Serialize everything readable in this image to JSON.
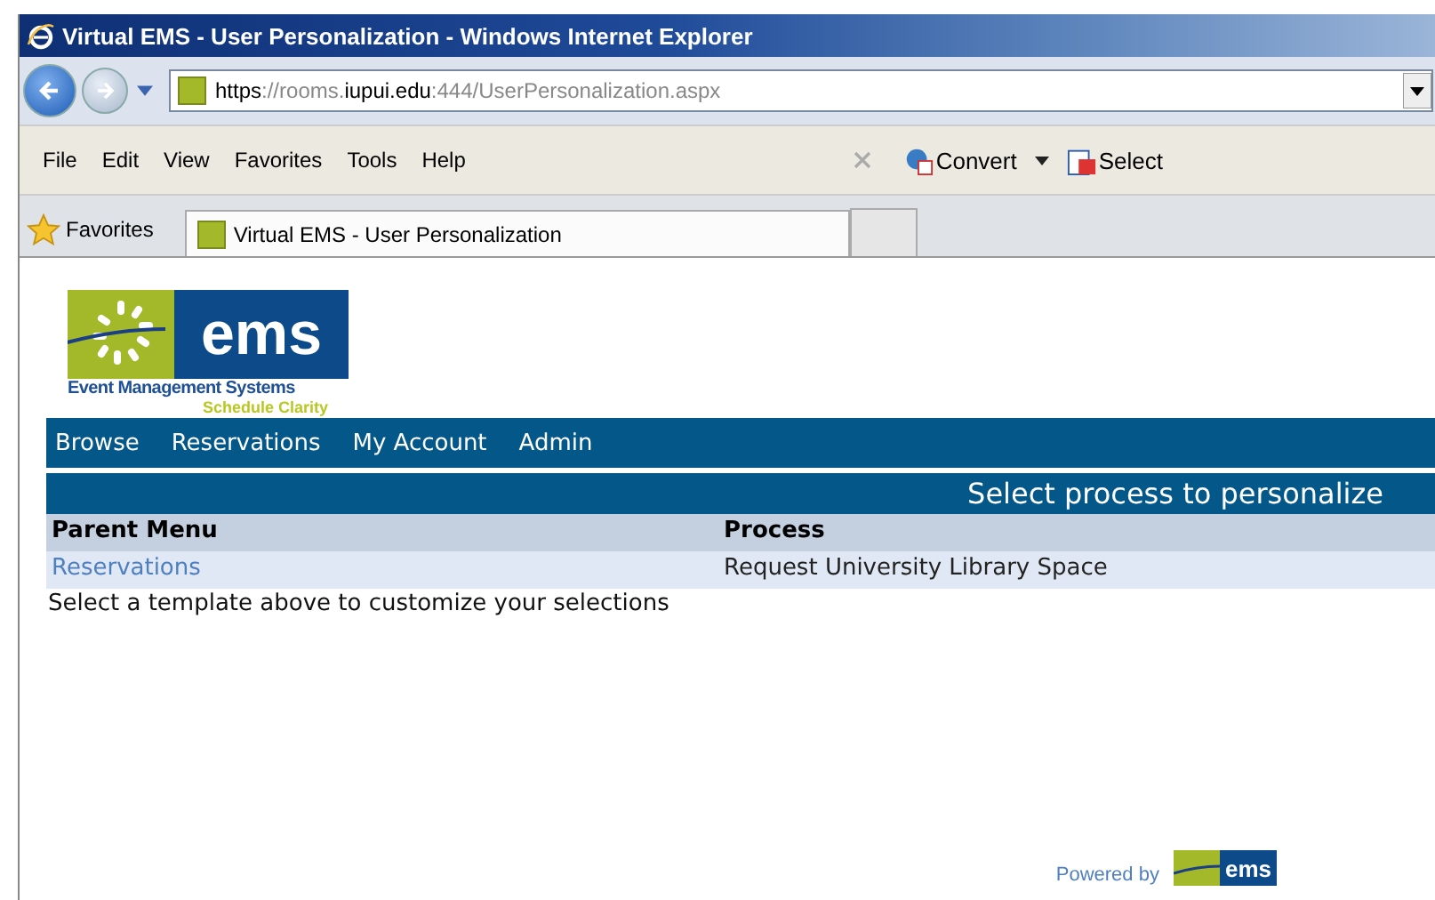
{
  "window": {
    "title": "Virtual EMS - User Personalization - Windows Internet Explorer"
  },
  "address_bar": {
    "url_parts": [
      {
        "text": "https",
        "dim": false
      },
      {
        "text": "://rooms.",
        "dim": true
      },
      {
        "text": "iupui.edu",
        "dim": false
      },
      {
        "text": ":444/UserPersonalization.aspx",
        "dim": true
      }
    ]
  },
  "menu": [
    "File",
    "Edit",
    "View",
    "Favorites",
    "Tools",
    "Help"
  ],
  "toolbar": {
    "convert": "Convert",
    "select": "Select"
  },
  "favorites_bar": {
    "label": "Favorites",
    "tabs": [
      {
        "label": "Virtual EMS - User Personalization",
        "selected": true
      }
    ]
  },
  "logo": {
    "mark": "ems",
    "line1": "Event Management Systems",
    "line2": "Schedule Clarity"
  },
  "nav": [
    "Browse",
    "Reservations",
    "My Account",
    "Admin"
  ],
  "section_title": "Select process to personalize",
  "table": {
    "columns": [
      "Parent Menu",
      "Process"
    ],
    "rows": [
      [
        "Reservations",
        "Request University Library Space"
      ]
    ]
  },
  "hint": "Select a template above to customize your selections",
  "footer": {
    "powered_by": "Powered by",
    "mark": "ems"
  }
}
